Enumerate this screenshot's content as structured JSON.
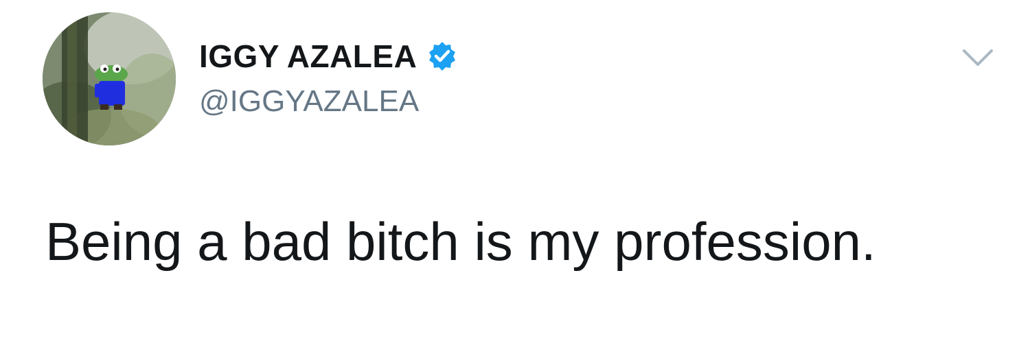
{
  "tweet": {
    "display_name": "IGGY AZALEA",
    "handle": "@IGGYAZALEA",
    "text": "Being a bad bitch is my profession.",
    "verified": true
  },
  "icons": {
    "avatar": "profile-avatar-image",
    "verified": "verified-badge-icon",
    "menu": "chevron-down-icon"
  },
  "colors": {
    "text_primary": "#14171a",
    "text_secondary": "#657786",
    "verified_blue": "#1da1f2",
    "caret_gray": "#aab8c2",
    "background": "#ffffff"
  }
}
